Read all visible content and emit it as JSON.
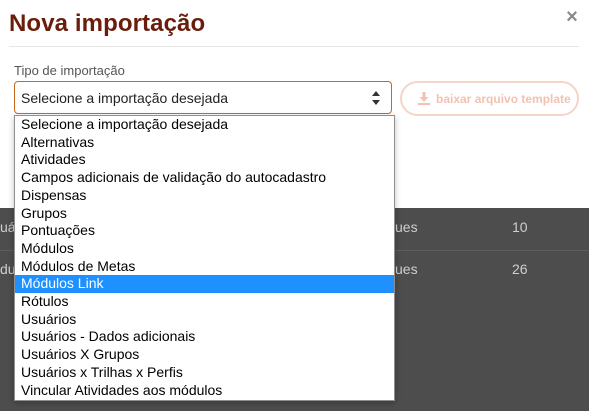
{
  "modal": {
    "title": "Nova importação",
    "close_glyph": "×",
    "field_label": "Tipo de importação",
    "select_value": "Selecione a importação desejada",
    "download_label": "baixar arquivo template"
  },
  "dropdown": {
    "options": [
      "Selecione a importação desejada",
      "Alternativas",
      "Atividades",
      "Campos adicionais de validação do autocadastro",
      "Dispensas",
      "Grupos",
      "Pontuações",
      "Módulos",
      "Módulos de Metas",
      "Módulos Link",
      "Rótulos",
      "Usuários",
      "Usuários - Dados adicionais",
      "Usuários X Grupos",
      "Usuários x Trilhas x Perfis",
      "Vincular Atividades aos módulos"
    ],
    "highlighted": "Módulos Link"
  },
  "background_table": {
    "rows": [
      {
        "c1": "uá",
        "c2": "ues",
        "c3": "10"
      },
      {
        "c1": "du",
        "c2": "ues",
        "c3": "26"
      }
    ]
  },
  "colors": {
    "title": "#6b1d0c",
    "select_border": "#c9691f",
    "download_disabled": "#f1c2b2",
    "highlight": "#1e90ff",
    "overlay": "#4d4d4d"
  },
  "icons": {
    "select_arrows": "up-down-arrows-icon",
    "download": "download-icon",
    "close": "close-icon"
  }
}
